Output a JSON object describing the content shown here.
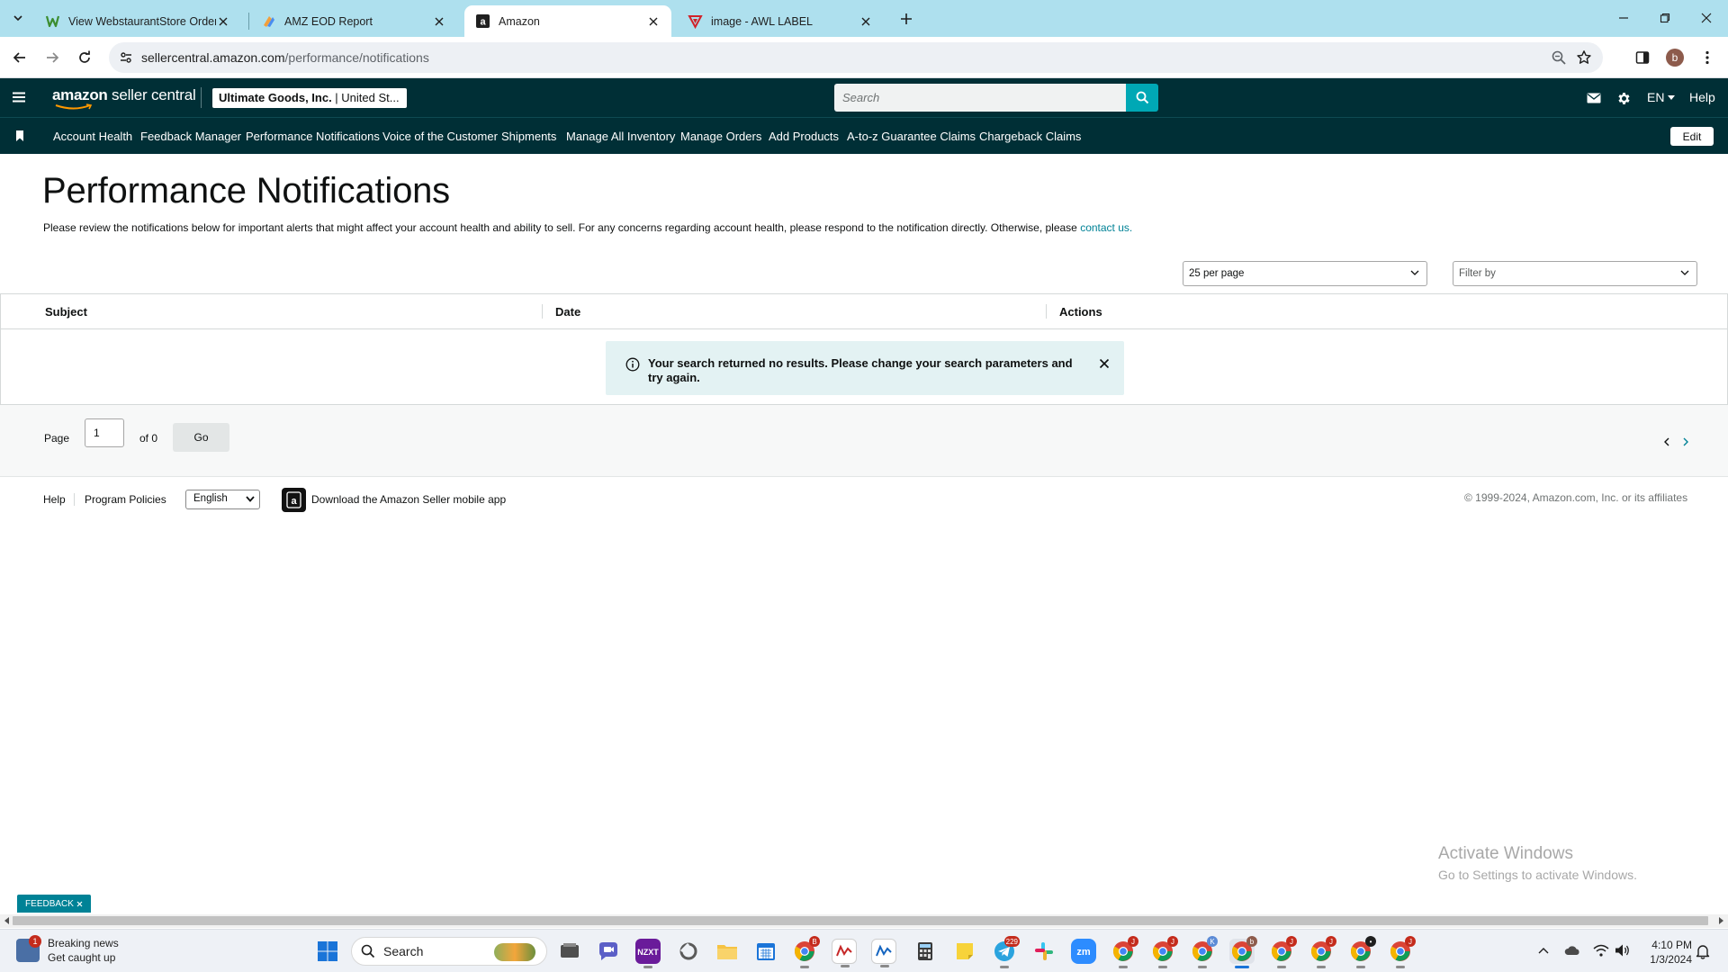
{
  "browser": {
    "tabs": [
      {
        "title": "View WebstaurantStore Orders",
        "favicon": "webstaurant-icon",
        "active": false
      },
      {
        "title": "AMZ EOD Report",
        "favicon": "sheets-logo-icon",
        "active": false
      },
      {
        "title": "Amazon",
        "favicon": "amazon-a-icon",
        "active": true
      },
      {
        "title": "image - AWL LABEL",
        "favicon": "awl-label-icon",
        "active": false
      }
    ],
    "url_host": "sellercentral.amazon.com",
    "url_path": "/performance/notifications",
    "profile_initial": "b"
  },
  "header": {
    "logo_bold": "amazon",
    "logo_rest": " seller central",
    "account_name": "Ultimate Goods, Inc.",
    "account_region": " | United St...",
    "search_placeholder": "Search",
    "language": "EN",
    "help": "Help"
  },
  "nav": {
    "links": [
      "Account Health",
      "Feedback Manager",
      "Performance Notifications",
      "Voice of the Customer",
      "Shipments",
      "Manage All Inventory",
      "Manage Orders",
      "Add Products",
      "A-to-z Guarantee Claims",
      "Chargeback Claims"
    ],
    "edit_label": "Edit"
  },
  "page": {
    "title": "Performance Notifications",
    "description": "Please review the notifications below for important alerts that might affect your account health and ability to sell. For any concerns regarding account health, please respond to the notification directly. Otherwise, please ",
    "contact_link": "contact us.",
    "per_page": "25 per page",
    "filter_placeholder": "Filter by"
  },
  "table": {
    "columns": [
      "Subject",
      "Date",
      "Actions"
    ],
    "empty_message": "Your search returned no results. Please change your search parameters and try again."
  },
  "pager": {
    "page_label": "Page",
    "current_page": "1",
    "of_label": "of 0",
    "go_label": "Go"
  },
  "footer": {
    "help": "Help",
    "program_policies": "Program Policies",
    "language_selected": "English",
    "app_text": "Download the Amazon Seller mobile app",
    "copyright": "© 1999-2024, Amazon.com, Inc. or its affiliates"
  },
  "watermark": {
    "line1": "Activate Windows",
    "line2": "Go to Settings to activate Windows."
  },
  "feedback_label": "FEEDBACK",
  "taskbar": {
    "news_title": "Breaking news",
    "news_subtitle": "Get caught up",
    "news_badge": "1",
    "search_label": "Search",
    "telegram_badge": "229",
    "time": "4:10 PM",
    "date": "1/3/2024"
  },
  "colors": {
    "seller_header": "#002f36",
    "search_button": "#00a8b5",
    "link": "#008296",
    "alert_bg": "#e3f2f3",
    "tab_strip": "#aee0ee"
  }
}
